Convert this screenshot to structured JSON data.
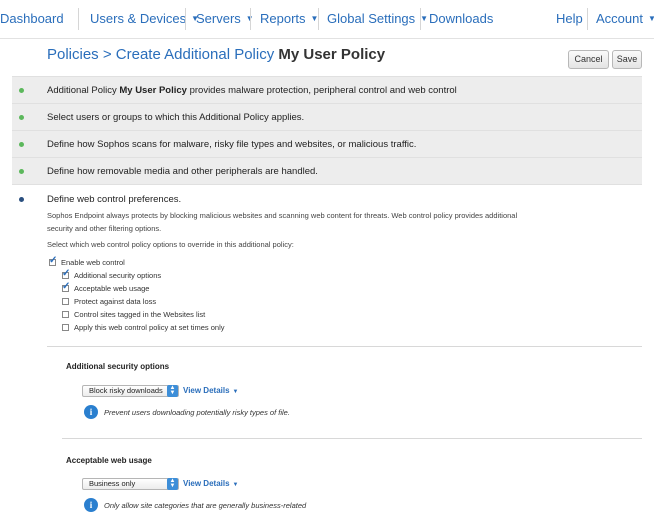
{
  "nav": {
    "dashboard": "Dashboard",
    "users_devices": "Users & Devices",
    "servers": "Servers",
    "reports": "Reports",
    "global_settings": "Global Settings",
    "downloads": "Downloads",
    "help": "Help",
    "account": "Account",
    "caret": "▼"
  },
  "header": {
    "breadcrumb_prefix": "Policies > Create Additional Policy ",
    "policy_name": "My User Policy",
    "cancel_label": "Cancel",
    "save_label": "Save"
  },
  "steps": [
    {
      "text_before": "Additional Policy ",
      "text_bold": "My User Policy",
      "text_after": " provides malware protection, peripheral control and web control",
      "status": "done"
    },
    {
      "text": "Select users or groups to which this Additional Policy applies.",
      "status": "done"
    },
    {
      "text": "Define how Sophos scans for malware, risky file types and websites, or malicious traffic.",
      "status": "done"
    },
    {
      "text": "Define how removable media and other peripherals are handled.",
      "status": "done"
    },
    {
      "text": "Define web control preferences.",
      "status": "current"
    }
  ],
  "web_control": {
    "desc_line1": "Sophos Endpoint always protects by blocking malicious websites and scanning web content for threats. Web control policy provides additional",
    "desc_line2": "security and other filtering options.",
    "override_prompt": "Select which web control policy options to override in this additional policy:",
    "enable": {
      "label": "Enable web control",
      "checked": true
    },
    "options": [
      {
        "label": "Additional security options",
        "checked": true
      },
      {
        "label": "Acceptable web usage",
        "checked": true
      },
      {
        "label": "Protect against data loss",
        "checked": false
      },
      {
        "label": "Control sites tagged in the Websites list",
        "checked": false
      },
      {
        "label": "Apply this web control policy at set times only",
        "checked": false
      }
    ]
  },
  "additional_security": {
    "title": "Additional security options",
    "select_value": "Block risky downloads",
    "view_details": "View Details",
    "info_symbol": "i",
    "info_text": "Prevent users downloading potentially risky types of file."
  },
  "acceptable_usage": {
    "title": "Acceptable web usage",
    "select_value": "Business only",
    "view_details": "View Details",
    "info_symbol": "i",
    "info_text": "Only allow site categories that are generally business-related"
  },
  "colors": {
    "accent": "#2a6ebb",
    "done_bullet": "#5cb85c",
    "current_bullet": "#2a4f7f",
    "step_bg": "#ededed"
  }
}
